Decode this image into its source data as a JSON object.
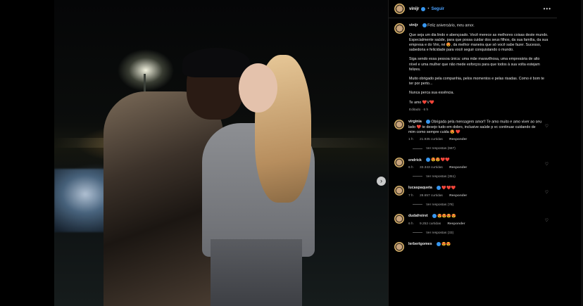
{
  "post": {
    "username": "vinijr",
    "follow_label": "Seguir",
    "separator": "•",
    "more": "•••",
    "next_arrow": "›"
  },
  "caption": {
    "username": "vinijr",
    "lines": [
      "Feliz aniversário, meu amor.",
      "Que seja um dia lindo e abençoado. Você merece as melhores coisas deste mundo. Especialmente saúde, para que possa cuidar dos seus filhos, da sua família, da sua empresa e do Vini, né 😍, da melhor maneira que só você sabe fazer. Sucesso, sabedoria e felicidade para você seguir conquistando o mundo.",
      "Siga sendo essa pessoa única: uma mãe maravilhosa, uma empresária de alto nível e uma mulher que não mede esforços para que todos à sua volta estejam felizes.",
      "Muito obrigado pela companhia, pelos momentos e pelas risadas. Como é bom te ter por perto...",
      "Nunca perca sua essência.",
      "Te amo ❤️V❤️"
    ],
    "meta": "Editado · 6 h"
  },
  "comments": [
    {
      "username": "virginia",
      "text": "Obrigada pela mensagem amor!! Te amo muito e amo viver ao seu lado ❤️ te desejo tudo em dobro, inclusive saúde p vc continuar cuidando de mim como sempre cuida 😍 ❤️",
      "time": "1 h",
      "likes": "21.935 curtidas",
      "reply": "Responder",
      "replies": "Ver respostas (687)"
    },
    {
      "username": "endrick",
      "text": "😍😍❤️❤️",
      "time": "6 h",
      "likes": "33.343 curtidas",
      "reply": "Responder",
      "replies": "Ver respostas (351)"
    },
    {
      "username": "lucaspaqueta",
      "text": "❤️❤️❤️",
      "time": "7 h",
      "likes": "28.657 curtidas",
      "reply": "Responder",
      "replies": "Ver respostas (78)"
    },
    {
      "username": "dudafreiret",
      "text": "😍😍😍😍",
      "time": "6 h",
      "likes": "9.252 curtidas",
      "reply": "Responder",
      "replies": "Ver respostas (33)"
    },
    {
      "username": "lerbertgomes",
      "text": "😍😍",
      "time": "",
      "likes": "",
      "reply": "",
      "replies": ""
    }
  ]
}
